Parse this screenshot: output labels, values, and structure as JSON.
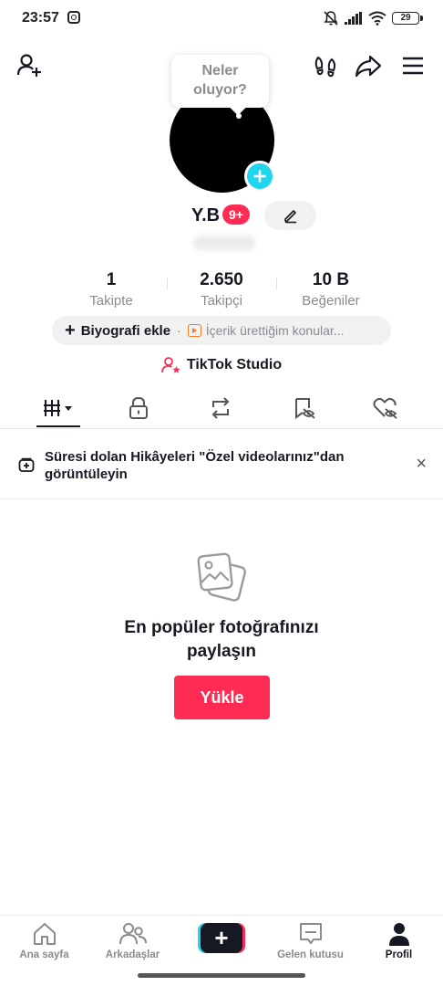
{
  "status_bar": {
    "time": "23:57",
    "battery": "29"
  },
  "header": {
    "bubble_text_line1": "Neler",
    "bubble_text_line2": "oluyor?"
  },
  "profile": {
    "name": "Y.B",
    "notification_badge": "9+"
  },
  "stats": [
    {
      "value": "1",
      "label": "Takipte"
    },
    {
      "value": "2.650",
      "label": "Takipçi"
    },
    {
      "value": "10 B",
      "label": "Beğeniler"
    }
  ],
  "bio": {
    "add_label": "Biyografi ekle",
    "separator": "·",
    "topics_label": "İçerik ürettiğim konular..."
  },
  "studio": {
    "label": "TikTok Studio"
  },
  "notice": {
    "text": "Süresi dolan Hikâyeleri \"Özel videolarınız\"dan görüntüleyin",
    "close": "×"
  },
  "empty_state": {
    "title_line1": "En popüler fotoğrafınızı",
    "title_line2": "paylaşın",
    "button": "Yükle"
  },
  "bottom_nav": {
    "home": "Ana sayfa",
    "friends": "Arkadaşlar",
    "create": "+",
    "inbox": "Gelen kutusu",
    "profile": "Profil"
  }
}
